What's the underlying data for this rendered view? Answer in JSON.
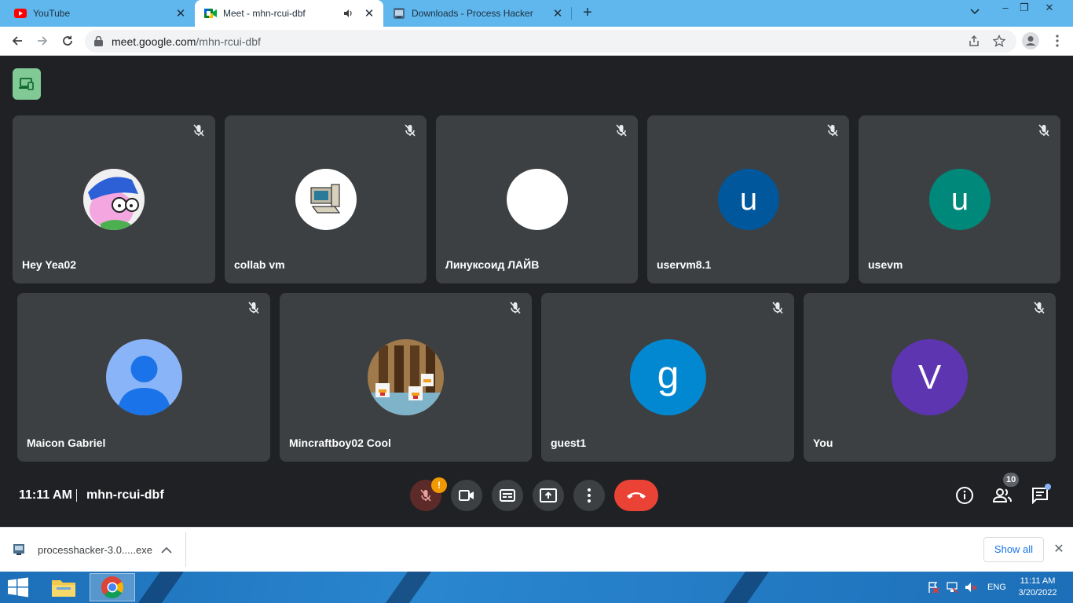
{
  "browser": {
    "tabs": [
      {
        "title": "YouTube",
        "icon": "youtube-icon"
      },
      {
        "title": "Meet - mhn-rcui-dbf",
        "icon": "google-meet-icon",
        "audio": true
      },
      {
        "title": "Downloads - Process Hacker",
        "icon": "process-hacker-icon"
      }
    ],
    "new_tab": "+",
    "window_controls": {
      "minimize": "–",
      "restore": "❒",
      "close": "✕"
    },
    "address": {
      "host": "meet.google.com",
      "path": "/mhn-rcui-dbf"
    }
  },
  "meet": {
    "participants": [
      {
        "name": "Hey Yea02",
        "avatar_type": "image",
        "avatar_desc": "cartoon-character"
      },
      {
        "name": "collab vm",
        "avatar_type": "image",
        "avatar_desc": "computer"
      },
      {
        "name": "Линуксоид ЛАЙВ",
        "avatar_type": "blank",
        "avatar_color": "#ffffff"
      },
      {
        "name": "uservm8.1",
        "avatar_type": "letter",
        "letter": "u",
        "avatar_color": "#01579b"
      },
      {
        "name": "usevm",
        "avatar_type": "letter",
        "letter": "u",
        "avatar_color": "#00897b"
      },
      {
        "name": "Maicon Gabriel",
        "avatar_type": "default",
        "avatar_color": "#8ab4f8"
      },
      {
        "name": "Mincraftboy02 Cool",
        "avatar_type": "image",
        "avatar_desc": "minecraft-chickens"
      },
      {
        "name": "guest1",
        "avatar_type": "letter",
        "letter": "g",
        "avatar_color": "#0288d1"
      },
      {
        "name": "You",
        "avatar_type": "letter",
        "letter": "V",
        "avatar_color": "#5e35b1"
      }
    ],
    "time": "11:11 AM",
    "meeting_code": "mhn-rcui-dbf",
    "mic_warning": "!",
    "people_count": "10"
  },
  "downloads": {
    "file": "processhacker-3.0.....exe",
    "show_all": "Show all",
    "close": "✕"
  },
  "taskbar": {
    "language": "ENG",
    "time": "11:11 AM",
    "date": "3/20/2022"
  },
  "colors": {
    "tabstrip": "#5fb7ee",
    "meet_bg": "#202124",
    "tile_bg": "#3c4043",
    "end_call": "#ea4335",
    "cast_button": "#81c995"
  }
}
